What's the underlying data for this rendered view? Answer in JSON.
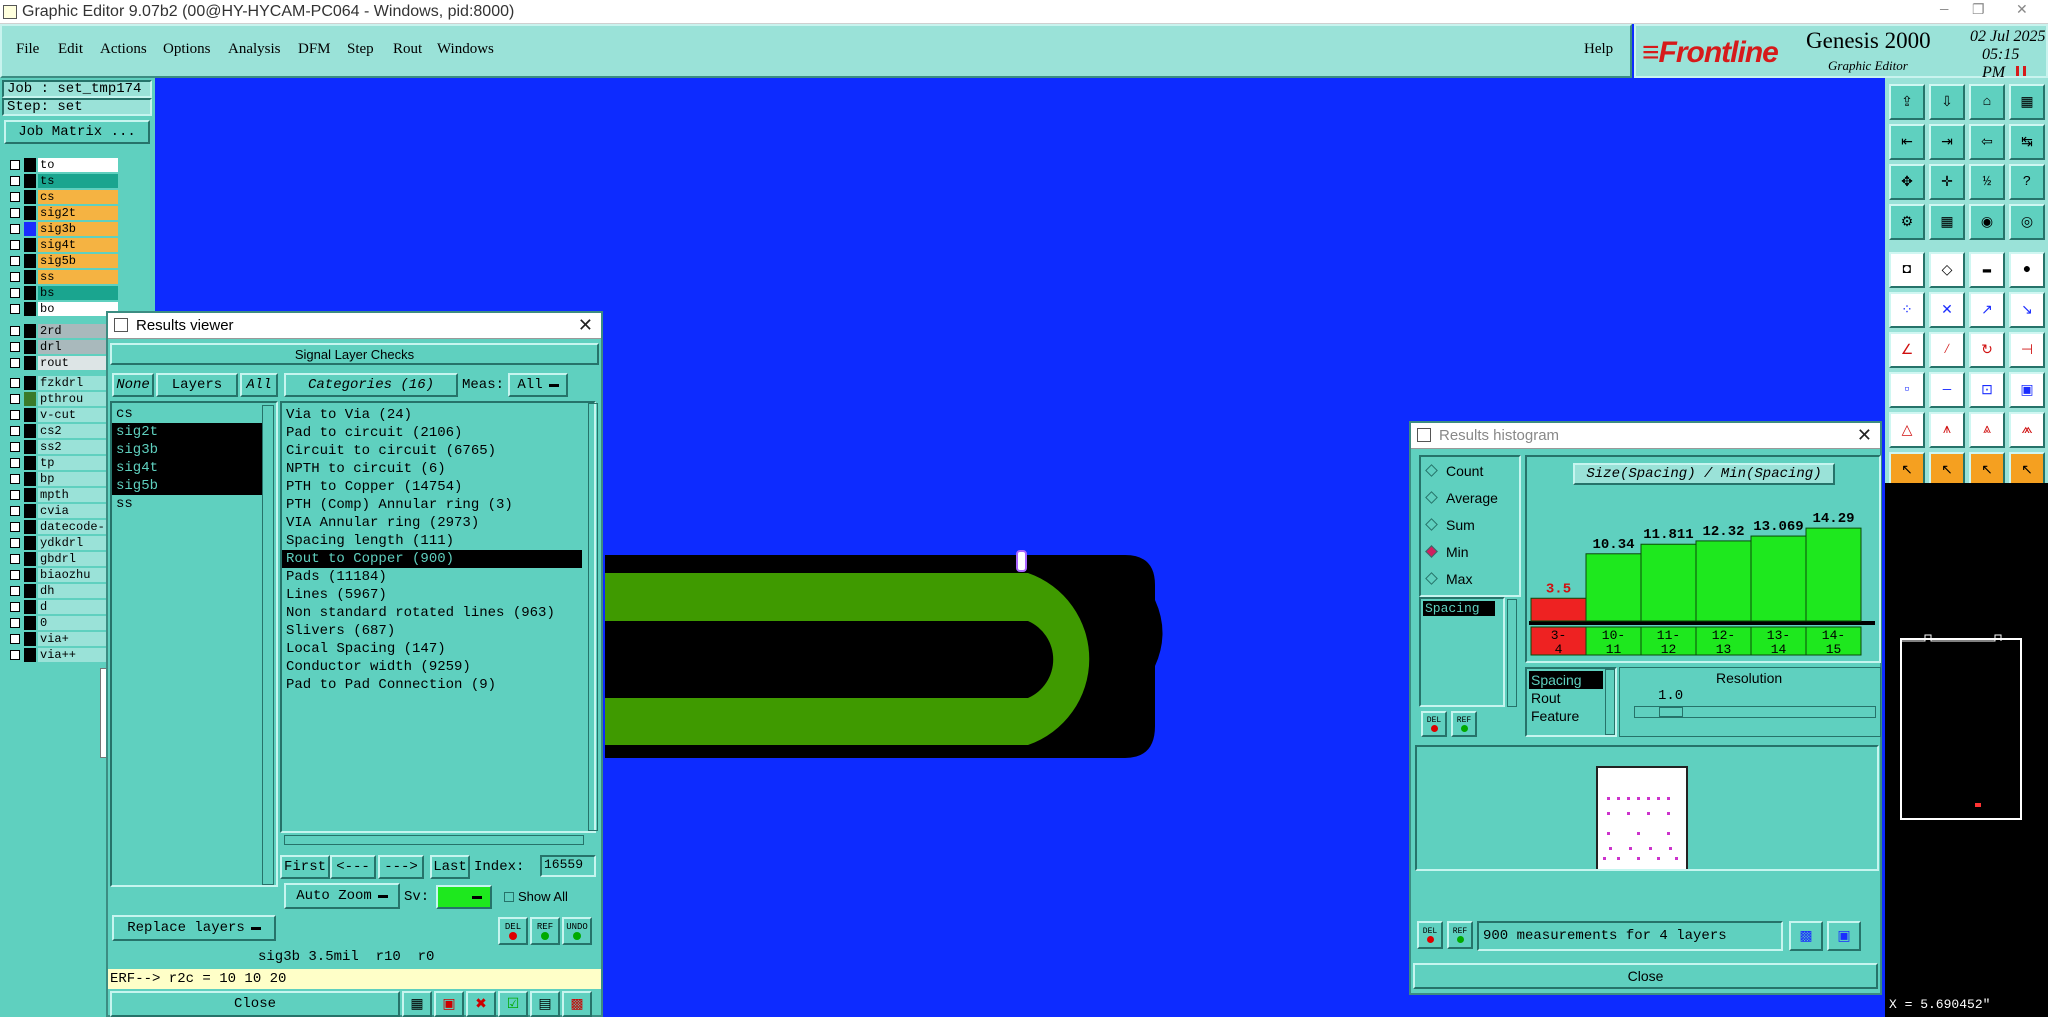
{
  "titlebar": {
    "title": "Graphic Editor 9.07b2 (00@HY-HYCAM-PC064 - Windows, pid:8000)"
  },
  "menu": {
    "items": [
      "File",
      "Edit",
      "Actions",
      "Options",
      "Analysis",
      "DFM",
      "Step",
      "Rout",
      "Windows"
    ],
    "help": "Help"
  },
  "brand": {
    "logo": "Frontline",
    "product": "Genesis 2000",
    "subtitle": "Graphic Editor",
    "date": "02 Jul 2025",
    "time": "05:15 PM"
  },
  "job": {
    "job_label": "Job : set_tmp174",
    "step_label": "Step: set",
    "matrix_button": "Job Matrix ..."
  },
  "layers": [
    {
      "name": "to",
      "bg": "#ffffff",
      "sw": "#000000"
    },
    {
      "name": "ts",
      "bg": "#1aa58f",
      "sw": "#000000"
    },
    {
      "name": "cs",
      "bg": "#f5b342",
      "sw": "#000000"
    },
    {
      "name": "sig2t",
      "bg": "#f5b342",
      "sw": "#000000"
    },
    {
      "name": "sig3b",
      "bg": "#f5b342",
      "sw": "#1a2cff"
    },
    {
      "name": "sig4t",
      "bg": "#f5b342",
      "sw": "#000000"
    },
    {
      "name": "sig5b",
      "bg": "#f5b342",
      "sw": "#000000"
    },
    {
      "name": "ss",
      "bg": "#f5b342",
      "sw": "#000000"
    },
    {
      "name": "bs",
      "bg": "#1aa58f",
      "sw": "#000000"
    },
    {
      "name": "bo",
      "bg": "#ffffff",
      "sw": "#000000"
    }
  ],
  "layers2": [
    {
      "name": "2rd",
      "bg": "#a9b9bc"
    },
    {
      "name": "drl",
      "bg": "#a9b9bc"
    },
    {
      "name": "rout",
      "bg": "#dde5e6"
    }
  ],
  "layers3": [
    "fzkdrl",
    "pthrou",
    "v-cut",
    "cs2",
    "ss2",
    "tp",
    "bp",
    "mpth",
    "cvia",
    "datecode-",
    "ydkdrl",
    "gbdrl",
    "biaozhu",
    "dh",
    "d",
    "0",
    "via+",
    "via++"
  ],
  "results_viewer": {
    "title": "Results viewer",
    "header": "Signal Layer Checks",
    "none_btn": "None",
    "layers_btn": "Layers",
    "all_btn": "All",
    "layers": [
      "cs",
      "sig2t",
      "sig3b",
      "sig4t",
      "sig5b",
      "ss"
    ],
    "categories_btn": "Categories (16)",
    "meas_label": "Meas:",
    "meas_value": "All",
    "categories": [
      "Via to Via (24)",
      "Pad to circuit (2106)",
      "Circuit to circuit (6765)",
      "NPTH to circuit (6)",
      "PTH to Copper (14754)",
      "PTH (Comp) Annular ring (3)",
      "VIA Annular ring (2973)",
      "Spacing length (111)",
      "Rout to Copper (900)",
      "Pads (11184)",
      "Lines (5967)",
      "Non standard rotated lines (963)",
      "Slivers (687)",
      "Local Spacing (147)",
      "Conductor width (9259)",
      "Pad to Pad Connection (9)"
    ],
    "nav": {
      "first": "First",
      "prev": "<---",
      "next": "--->",
      "last": "Last",
      "index_label": "Index:",
      "index_value": "16559"
    },
    "auto_zoom": "Auto Zoom",
    "sv_label": "Sv:",
    "show_all": "Show All",
    "replace_layers": "Replace layers",
    "icons": {
      "del": "DEL",
      "ref": "REF",
      "undo": "UNDO"
    },
    "status": "sig3b 3.5mil  r10  r0",
    "erf": "ERF--> r2c = 10 10 20",
    "close": "Close"
  },
  "histogram": {
    "title": "Results histogram",
    "modes": [
      "Count",
      "Average",
      "Sum",
      "Min",
      "Max"
    ],
    "selected_mode": "Min",
    "measure": "Spacing",
    "chart_title": "Size(Spacing) / Min(Spacing)",
    "resolution_label": "Resolution",
    "resolution_value": "1.0",
    "options": [
      "Spacing",
      "Rout",
      "Feature"
    ],
    "footer": "900 measurements for 4 layers",
    "close": "Close"
  },
  "chart_data": {
    "type": "bar",
    "title": "Size(Spacing) / Min(Spacing)",
    "categories": [
      "3-4",
      "10-11",
      "11-12",
      "12-13",
      "13-14",
      "14-15"
    ],
    "values": [
      3.5,
      10.34,
      11.811,
      12.32,
      13.069,
      14.29
    ],
    "value_labels": [
      "3.5",
      "10.34",
      "11.811",
      "12.32",
      "13.069",
      "14.29"
    ],
    "colors": [
      "#ee2222",
      "#1ee81e",
      "#1ee81e",
      "#1ee81e",
      "#1ee81e",
      "#1ee81e"
    ]
  },
  "coords": {
    "readout": "X = 5.690452\""
  }
}
